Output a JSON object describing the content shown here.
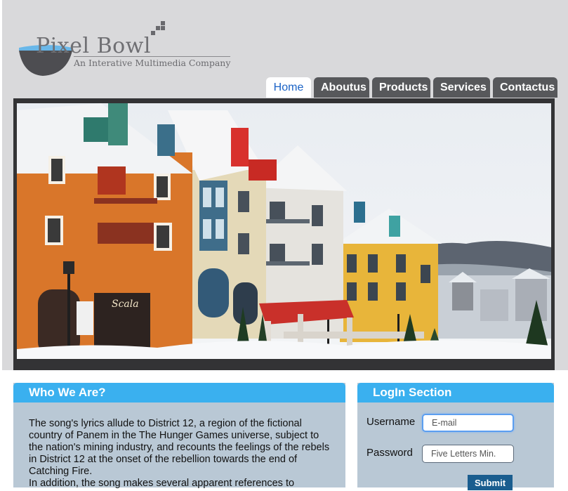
{
  "logo": {
    "title": "Pixel Bowl",
    "subtitle": "An Interative Multimedia Company"
  },
  "nav": {
    "items": [
      {
        "label": "Home",
        "active": true
      },
      {
        "label": "Aboutus"
      },
      {
        "label": "Products"
      },
      {
        "label": "Services"
      },
      {
        "label": "Contactus"
      }
    ]
  },
  "banner": {
    "sign_text": "Scala"
  },
  "who": {
    "title": "Who We Are?",
    "paragraph1": "The song's lyrics allude to District 12, a region of the fictional country of Panem in the The Hunger Games universe, subject to the nation's mining industry, and recounts the feelings of the rebels in District 12 at the onset of the rebellion towards the end of Catching Fire.",
    "paragraph2": "In addition, the song makes several apparent references to"
  },
  "login": {
    "title": "LogIn Section",
    "username_label": "Username",
    "username_placeholder": "E-mail",
    "password_label": "Password",
    "password_placeholder": "Five Letters Min.",
    "submit_label": "Submit"
  },
  "colors": {
    "accent": "#3ab0ef",
    "nav_bg": "#57585b",
    "panel_bg": "#b9c8d5",
    "header_bg": "#d9d9db"
  }
}
